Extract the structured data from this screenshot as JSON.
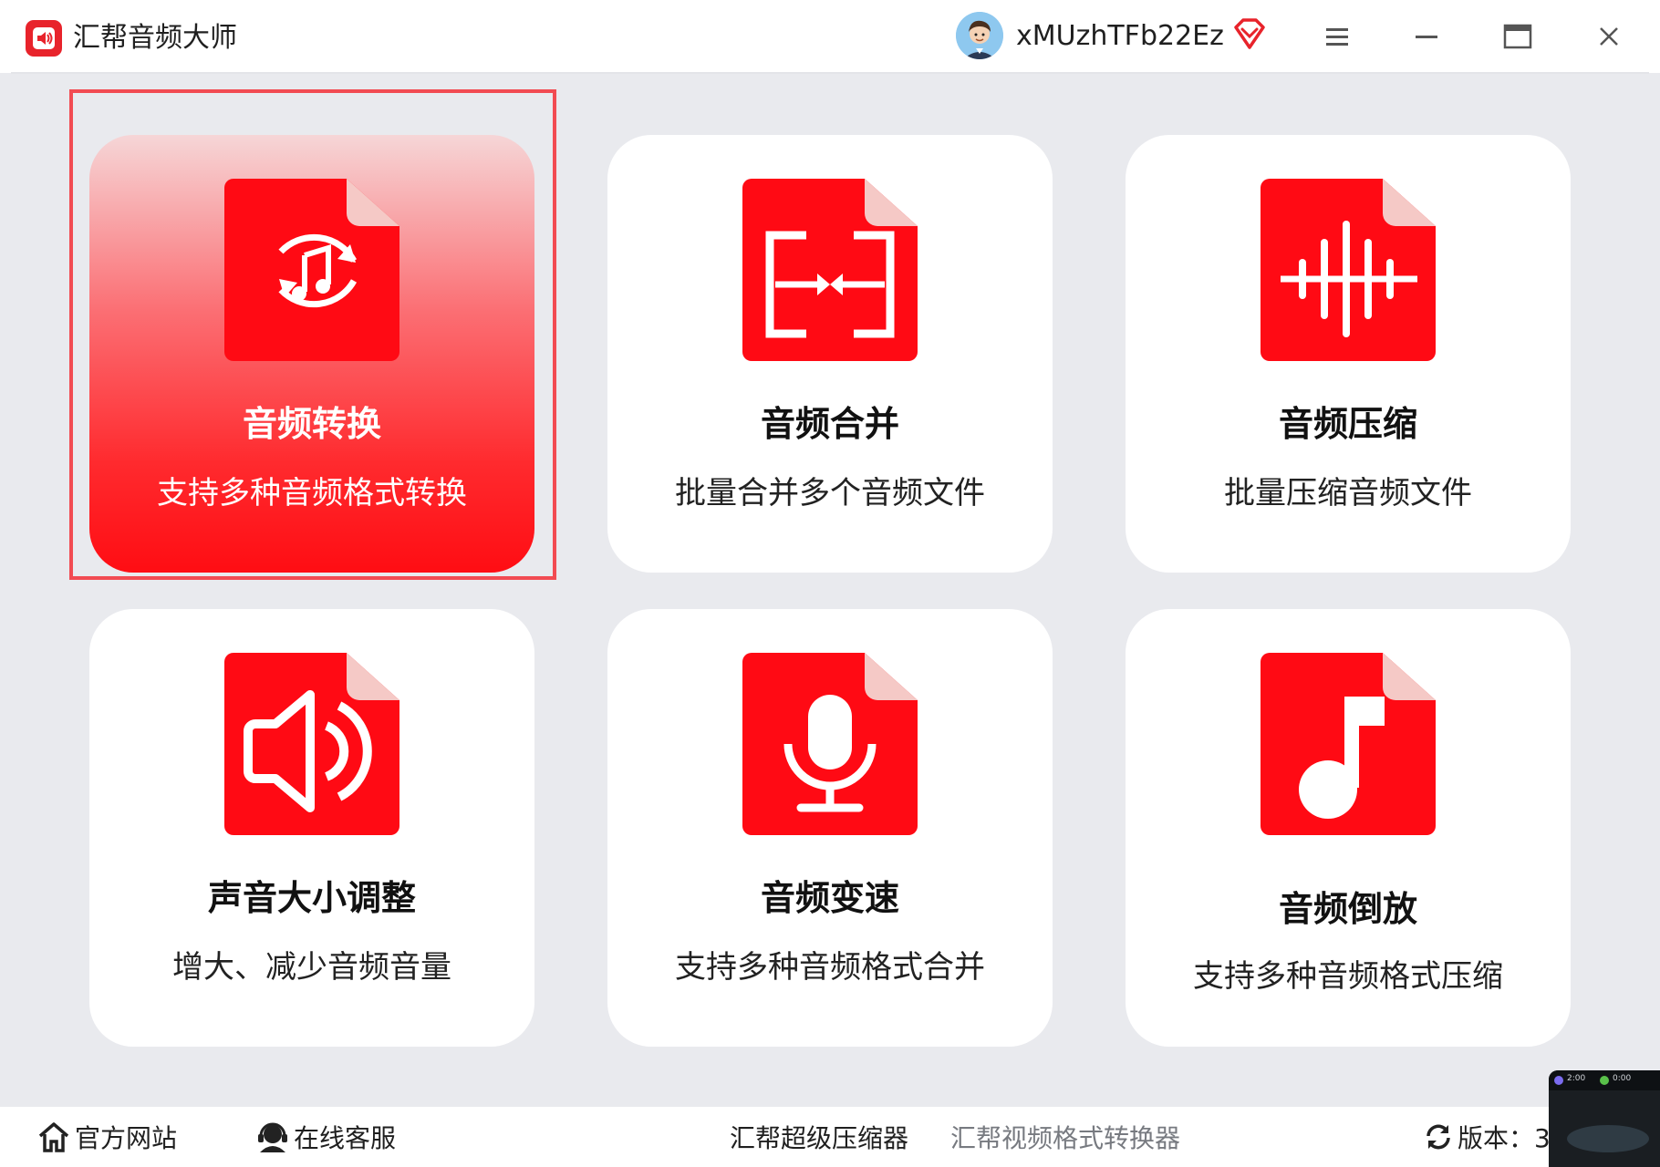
{
  "app": {
    "title": "汇帮音频大师",
    "username": "xMUzhTFb22Ez"
  },
  "window_controls": {
    "menu": "menu-icon",
    "minimize": "minimize-icon",
    "maximize": "maximize-icon",
    "close": "close-icon"
  },
  "cards": [
    {
      "title": "音频转换",
      "desc": "支持多种音频格式转换",
      "icon": "audio-convert-icon",
      "selected": true
    },
    {
      "title": "音频合并",
      "desc": "批量合并多个音频文件",
      "icon": "audio-merge-icon",
      "selected": false
    },
    {
      "title": "音频压缩",
      "desc": "批量压缩音频文件",
      "icon": "audio-compress-icon",
      "selected": false
    },
    {
      "title": "声音大小调整",
      "desc": "增大、减少音频音量",
      "icon": "volume-icon",
      "selected": false
    },
    {
      "title": "音频变速",
      "desc": "支持多种音频格式合并",
      "icon": "microphone-icon",
      "selected": false
    },
    {
      "title": "音频倒放",
      "desc": "支持多种音频格式压缩",
      "icon": "music-note-icon",
      "selected": false
    }
  ],
  "footer": {
    "website": "官方网站",
    "support": "在线客服",
    "compressor": "汇帮超级压缩器",
    "video_converter": "汇帮视频格式转换器",
    "version_label": "版本：3"
  },
  "thumbnail": {
    "time_a": "2:00",
    "time_b": "0:00"
  },
  "colors": {
    "brand_red": "#ff0d13",
    "highlight_border": "#f24b52",
    "background": "#e9eaee"
  }
}
